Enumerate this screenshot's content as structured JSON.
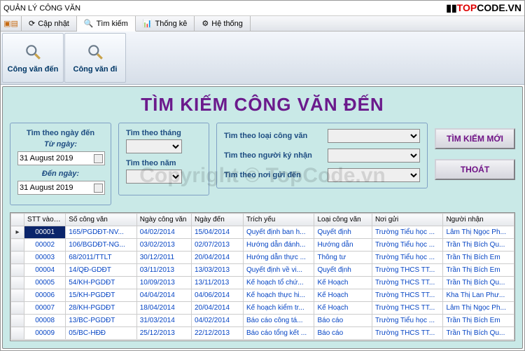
{
  "window": {
    "title": "QUẢN LÝ CÔNG VĂN"
  },
  "brand": {
    "part1": "TOP",
    "part2": "CODE.VN"
  },
  "menu": {
    "items": [
      "Cập nhật",
      "Tìm kiếm",
      "Thống kê",
      "Hệ thống"
    ],
    "active_index": 1
  },
  "toolbar": {
    "btn1": "Công văn đến",
    "btn2": "Công văn đi"
  },
  "heading": "TÌM KIẾM CÔNG VĂN ĐẾN",
  "search": {
    "date_panel_title": "Tìm theo ngày đến",
    "from_label": "Từ ngày:",
    "to_label": "Đến ngày:",
    "from_value": "31  August   2019",
    "to_value": "31  August   2019",
    "month_label": "Tìm theo tháng",
    "year_label": "Tìm theo năm",
    "type_label": "Tìm theo loại công văn",
    "signer_label": "Tìm theo người ký nhận",
    "sender_label": "Tìm theo nơi gửi đến"
  },
  "buttons": {
    "search_new": "TÌM KIẾM MỚI",
    "exit": "THOÁT"
  },
  "table": {
    "headers": [
      "STT vào số",
      "Số công văn",
      "Ngày công văn",
      "Ngày đến",
      "Trích yếu",
      "Loại công văn",
      "Nơi gửi",
      "Người nhận"
    ],
    "rows": [
      [
        "00001",
        "165/PGDĐT-NV...",
        "04/02/2014",
        "15/04/2014",
        "Quyết định ban h...",
        "Quyết định",
        "Trường Tiểu học ...",
        "Lâm Thị Ngọc Ph..."
      ],
      [
        "00002",
        "106/BGDĐT-NG...",
        "03/02/2013",
        "02/07/2013",
        "Hướng dẫn đánh...",
        "Hướng dẫn",
        "Trường Tiểu học ...",
        "Trần Thị Bích Qu..."
      ],
      [
        "00003",
        "68/2011/TTLT",
        "30/12/2011",
        "20/04/2014",
        "Hướng dẫn thực ...",
        "Thông tư",
        "Trường Tiểu học ...",
        "Trần Thị Bích Em"
      ],
      [
        "00004",
        "14/QĐ-GDĐT",
        "03/11/2013",
        "13/03/2013",
        "Quyết định về vi...",
        "Quyết định",
        "Trường THCS TT...",
        "Trần Thị Bích Em"
      ],
      [
        "00005",
        "54/KH-PGDĐT",
        "10/09/2013",
        "13/11/2013",
        "Kế hoạch tổ chứ...",
        "Kế Hoạch",
        "Trường THCS TT...",
        "Trần Thị Bích Qu..."
      ],
      [
        "00006",
        "15/KH-PGDĐT",
        "04/04/2014",
        "04/06/2014",
        "Kế hoạch thực hi...",
        "Kế Hoạch",
        "Trường THCS TT...",
        "Kha Thị Lan Phư..."
      ],
      [
        "00007",
        "28/KH-PGDĐT",
        "18/04/2014",
        "20/04/2014",
        "Kế hoạch kiểm tr...",
        "Kế Hoạch",
        "Trường THCS TT...",
        "Lâm Thị Ngọc Ph..."
      ],
      [
        "00008",
        "13/BC-PGDĐT",
        "31/03/2014",
        "04/02/2014",
        "Báo cáo công tá...",
        "Báo cáo",
        "Trường Tiểu học ...",
        "Trần Thị Bích Em"
      ],
      [
        "00009",
        "05/BC-HĐĐ",
        "25/12/2013",
        "22/12/2013",
        "Báo cáo tổng kết ...",
        "Báo cáo",
        "Trường THCS TT...",
        "Trần Thị Bích Qu..."
      ]
    ]
  },
  "watermark": "Copyright © TopCode.vn"
}
